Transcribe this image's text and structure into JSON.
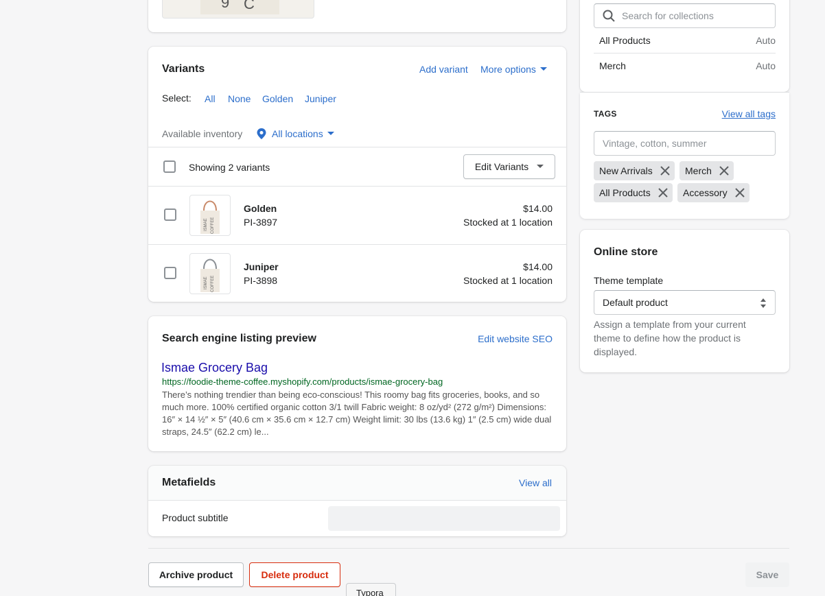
{
  "variants": {
    "title": "Variants",
    "add_variant": "Add variant",
    "more_options": "More options",
    "select_label": "Select:",
    "select_options": [
      "All",
      "None",
      "Golden",
      "Juniper"
    ],
    "inventory_label": "Available inventory",
    "locations": "All locations",
    "showing": "Showing 2 variants",
    "edit_variants": "Edit Variants",
    "rows": [
      {
        "name": "Golden",
        "sku": "PI-3897",
        "price": "$14.00",
        "stock": "Stocked at 1 location"
      },
      {
        "name": "Juniper",
        "sku": "PI-3898",
        "price": "$14.00",
        "stock": "Stocked at 1 location"
      }
    ]
  },
  "seo": {
    "title": "Search engine listing preview",
    "edit": "Edit website SEO",
    "page_title": "Ismae Grocery Bag",
    "url": "https://foodie-theme-coffee.myshopify.com/products/ismae-grocery-bag",
    "description": "There’s nothing trendier than being eco-conscious! This roomy bag fits groceries, books, and so much more. 100% certified organic cotton 3/1 twill Fabric weight: 8 oz/yd² (272 g/m²) Dimensions: 16″ × 14 ½″ × 5″ (40.6 cm × 35.6 cm × 12.7 cm) Weight limit: 30 lbs (13.6 kg) 1″ (2.5 cm) wide dual straps, 24.5″ (62.2 cm) le..."
  },
  "metafields": {
    "title": "Metafields",
    "view_all": "View all",
    "field_label": "Product subtitle"
  },
  "footer": {
    "archive": "Archive product",
    "delete": "Delete product",
    "save": "Save"
  },
  "collections": {
    "search_placeholder": "Search for collections",
    "items": [
      {
        "name": "All Products",
        "type": "Auto"
      },
      {
        "name": "Merch",
        "type": "Auto"
      }
    ]
  },
  "tags": {
    "heading": "TAGS",
    "view_all": "View all tags",
    "placeholder": "Vintage, cotton, summer",
    "items": [
      "New Arrivals",
      "Merch",
      "All Products",
      "Accessory"
    ]
  },
  "online_store": {
    "title": "Online store",
    "template_label": "Theme template",
    "template_value": "Default product",
    "help": "Assign a template from your current theme to define how the product is displayed."
  },
  "tooltip": "Typora",
  "image_text": {
    "bag_print_top": "ISMAE",
    "bag_print_bottom": "COFFEE"
  }
}
